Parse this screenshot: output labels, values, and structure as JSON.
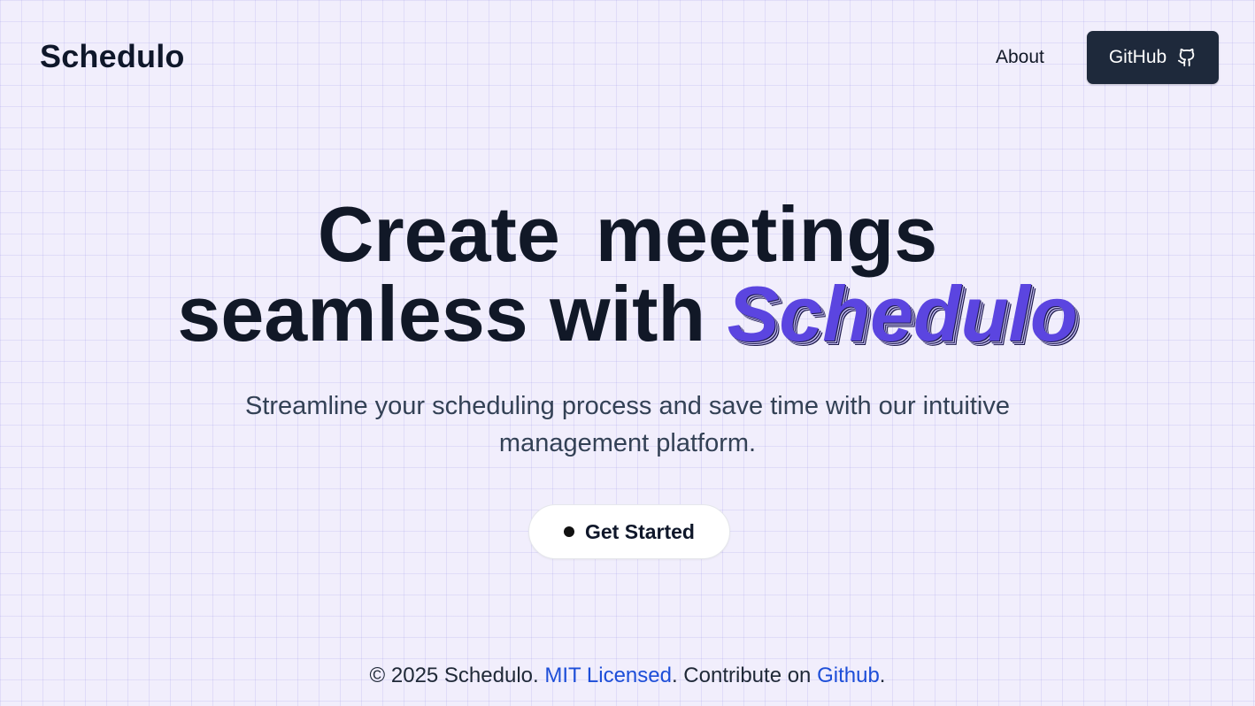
{
  "header": {
    "brand": "Schedulo",
    "nav": {
      "about_label": "About",
      "github_label": "GitHub",
      "github_icon": "github-icon"
    }
  },
  "hero": {
    "title_line1_word1": "Create",
    "title_line1_word2": "meetings",
    "title_line2_prefix": "seamless with ",
    "title_line2_accent": "Schedulo",
    "subtitle_line1": "Streamline your scheduling process and save time with our intuitive",
    "subtitle_line2": "management platform.",
    "cta_label": "Get Started",
    "accent_color": "#5b45e0"
  },
  "footer": {
    "copyright": "© 2025 Schedulo. ",
    "license_link": "MIT Licensed",
    "middle_text": ". Contribute on ",
    "github_link": "Github",
    "end_text": "."
  },
  "colors": {
    "background": "#f1eefc",
    "github_button": "#1e293b",
    "link": "#1d4ed8"
  }
}
